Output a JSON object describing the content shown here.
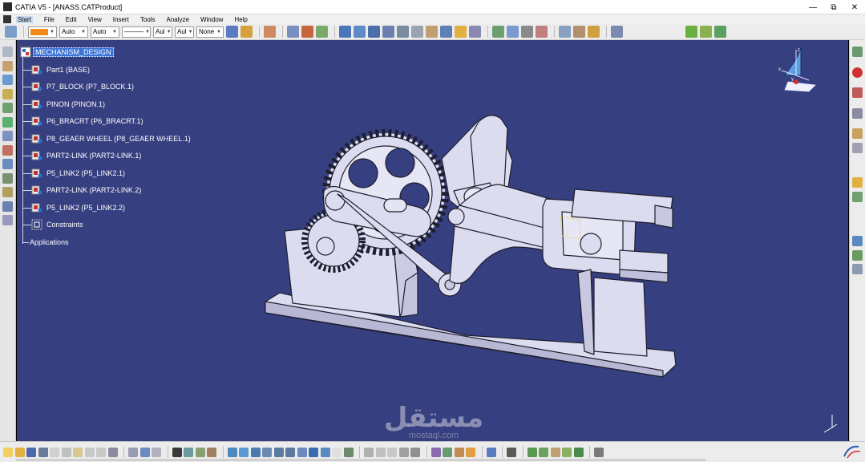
{
  "window": {
    "title": "CATIA V5 - [ANASS.CATProduct]",
    "minimize": "—",
    "restore": "⧉",
    "close": "✕"
  },
  "menu": [
    {
      "label": "Start",
      "active": true
    },
    {
      "label": "File"
    },
    {
      "label": "Edit"
    },
    {
      "label": "View"
    },
    {
      "label": "Insert"
    },
    {
      "label": "Tools"
    },
    {
      "label": "Analyze"
    },
    {
      "label": "Window"
    },
    {
      "label": "Help"
    }
  ],
  "toolbar": {
    "color_value": "#f28a1b",
    "transparency": "Auto",
    "line_thickness": "Auto",
    "line_type": "———",
    "layer": "Aul",
    "render_style": "Aul",
    "layer_filter": "None"
  },
  "tree": {
    "root": "MECHANISM_DESIGN",
    "items": [
      {
        "label": "Part1 (BASE)"
      },
      {
        "label": "P7_BLOCK (P7_BLOCK.1)"
      },
      {
        "label": "PINON (PINON.1)"
      },
      {
        "label": "P6_BRACRT (P6_BRACRT.1)"
      },
      {
        "label": "P8_GEAER WHEEL (P8_GEAER WHEEL.1)"
      },
      {
        "label": "PART2-LINK (PART2-LINK.1)"
      },
      {
        "label": "P5_LINK2 (P5_LINK2.1)"
      },
      {
        "label": "PART2-LINK (PART2-LINK.2)"
      },
      {
        "label": "P5_LINK2 (P5_LINK2.2)"
      },
      {
        "label": "Constraints"
      },
      {
        "label": "Applications"
      }
    ]
  },
  "compass": {
    "x_label": "x",
    "y_label": "y",
    "z_label": "z"
  },
  "watermark": {
    "text": "مستقل",
    "subtext": "mostaql.com"
  },
  "colors": {
    "viewport_bg": "#363f7f",
    "model_fill": "#dcdcf0",
    "model_stroke": "#1e1e2e",
    "highlight_yellow": "#e8d24a"
  },
  "icons": {
    "tree_product": "product-icon",
    "tree_part": "part-icon",
    "tree_constraints": "constraints-icon",
    "tree_applications": "applications-icon"
  }
}
